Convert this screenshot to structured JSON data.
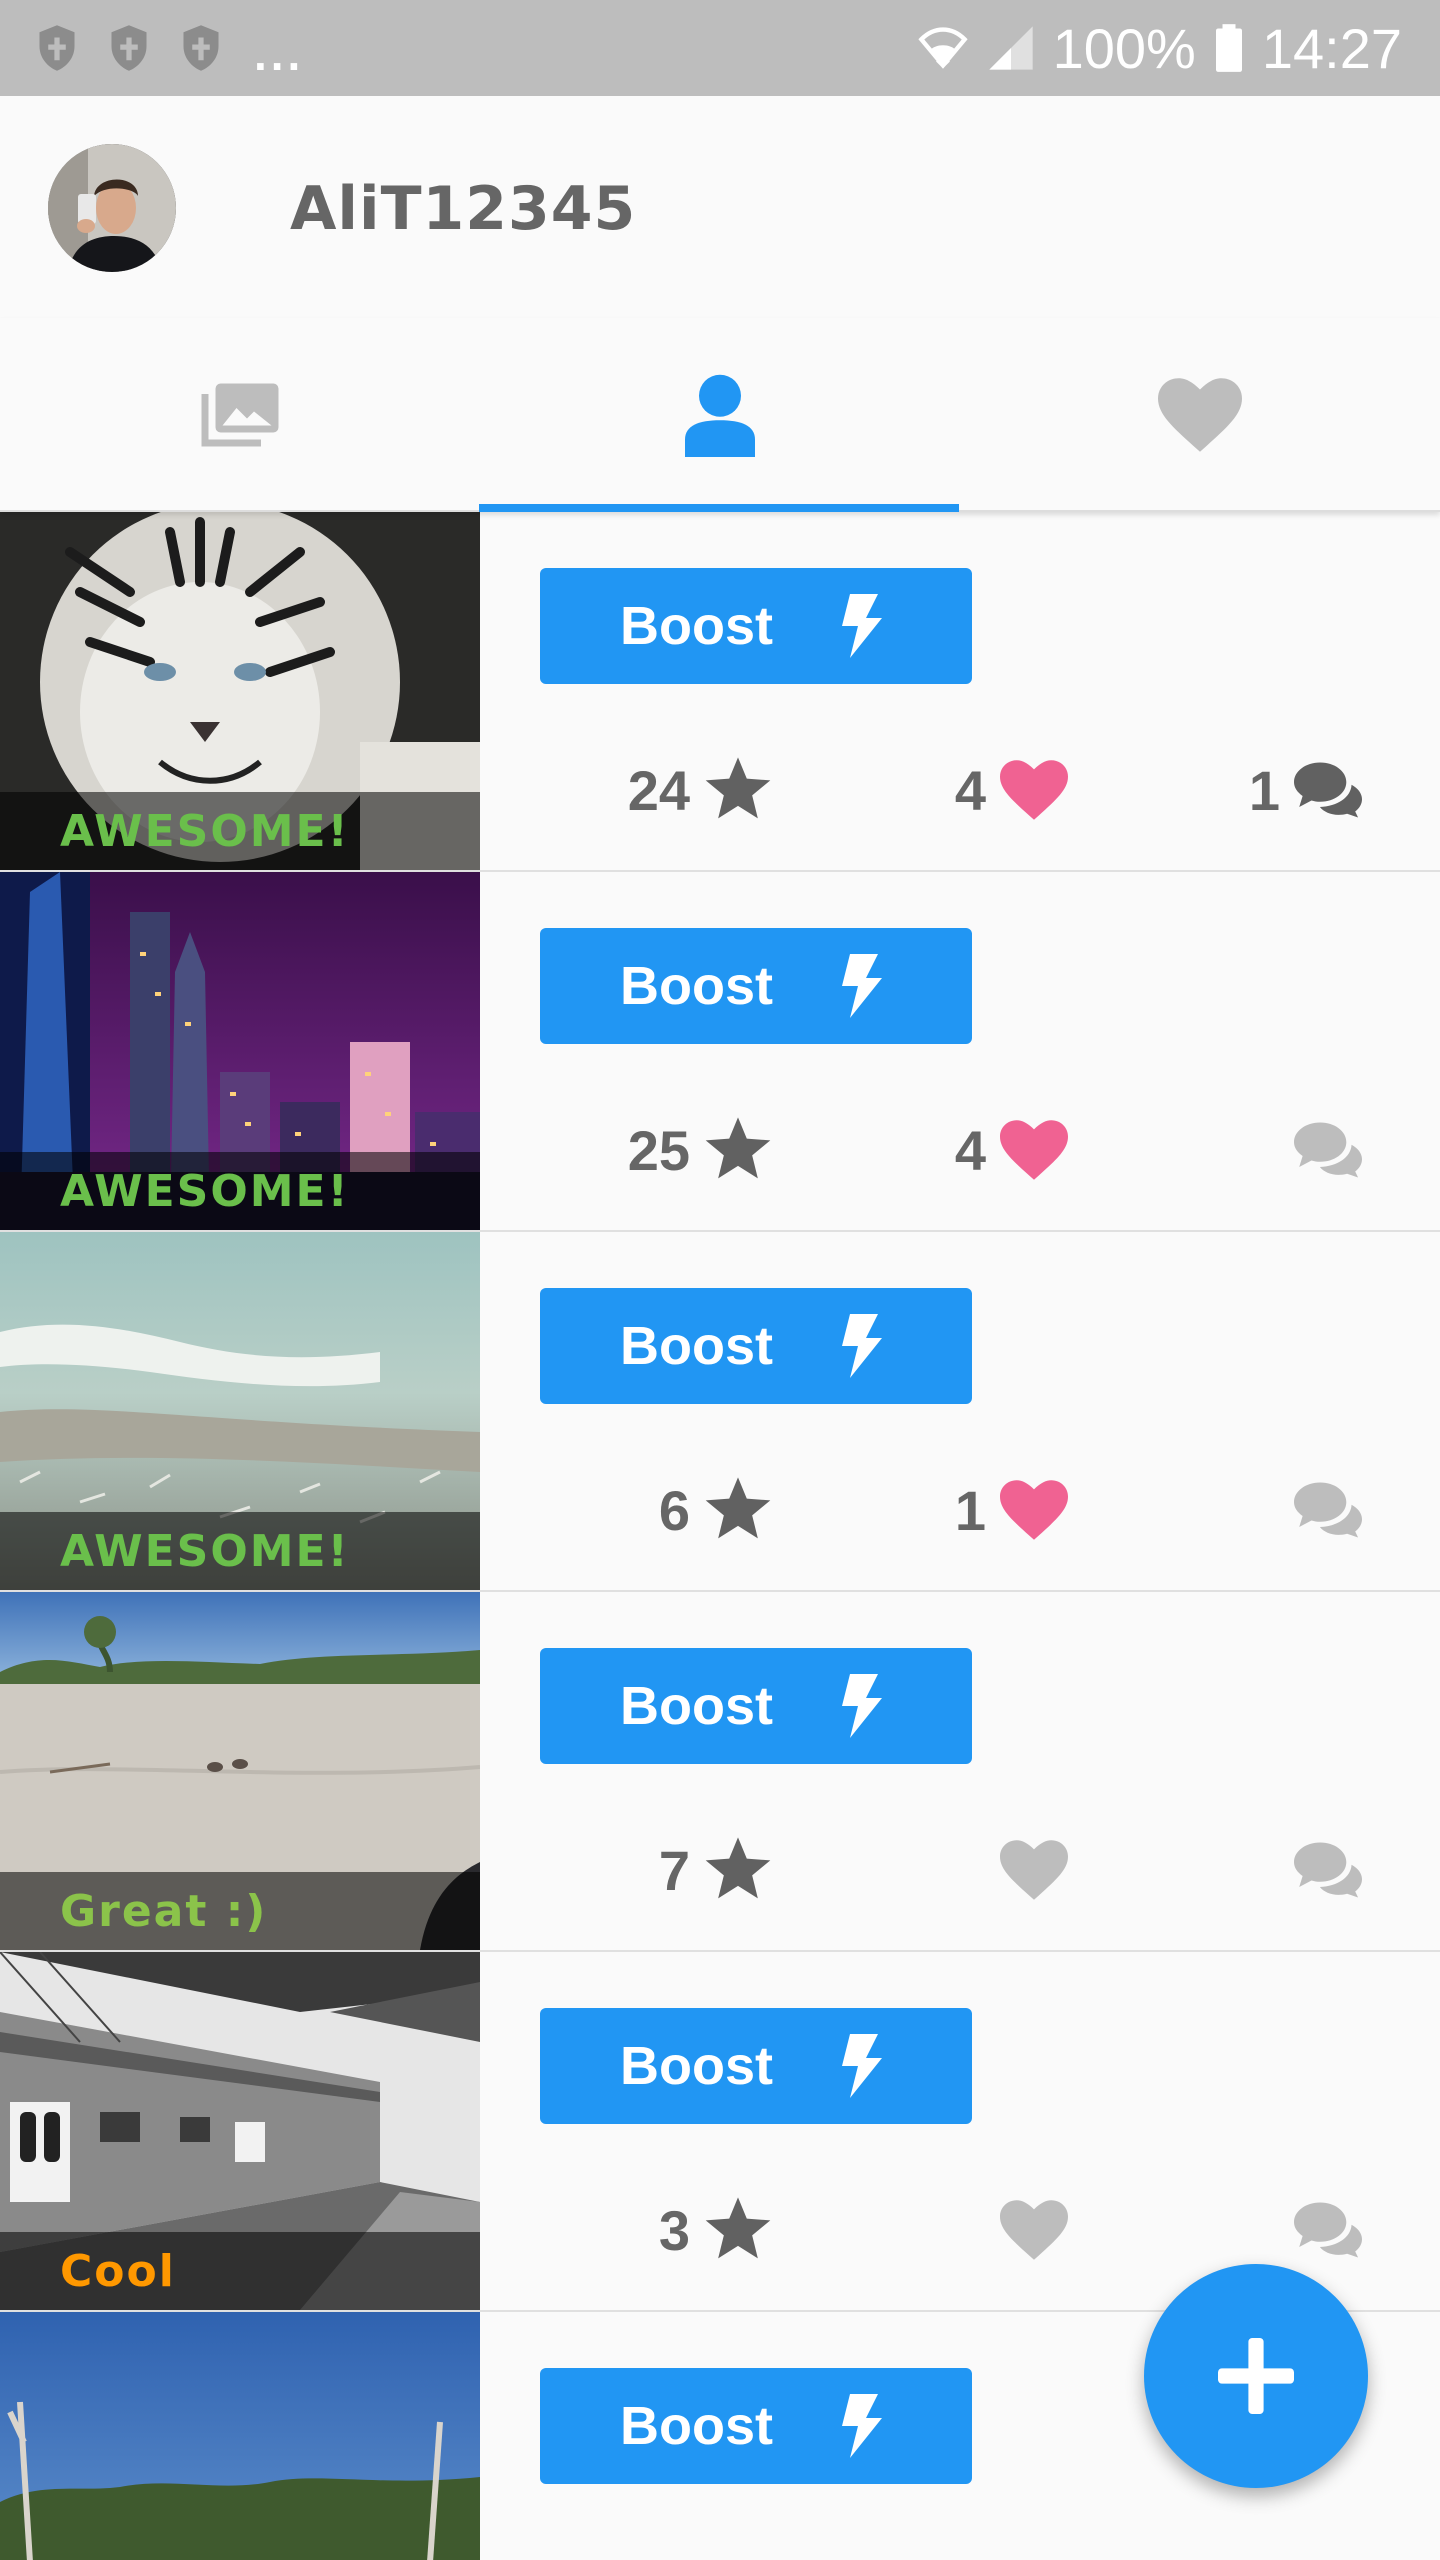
{
  "status_bar": {
    "notification_overflow": "...",
    "battery_percent": "100%",
    "time": "14:27"
  },
  "profile": {
    "username": "AliT12345"
  },
  "tabs": [
    {
      "icon": "photo-library-icon",
      "selected": false
    },
    {
      "icon": "person-icon",
      "selected": true
    },
    {
      "icon": "heart-icon",
      "selected": false
    }
  ],
  "posts": [
    {
      "caption": "AWESOME!",
      "caption_color": "#6abf4b",
      "boost_label": "Boost",
      "stars": "24",
      "likes": "4",
      "liked": true,
      "comments": "1",
      "has_comments": true
    },
    {
      "caption": "AWESOME!",
      "caption_color": "#6abf4b",
      "boost_label": "Boost",
      "stars": "25",
      "likes": "4",
      "liked": true,
      "comments": "",
      "has_comments": false
    },
    {
      "caption": "AWESOME!",
      "caption_color": "#6abf4b",
      "boost_label": "Boost",
      "stars": "6",
      "likes": "1",
      "liked": true,
      "comments": "",
      "has_comments": false
    },
    {
      "caption": "Great :)",
      "caption_color": "#8bc34a",
      "boost_label": "Boost",
      "stars": "7",
      "likes": "",
      "liked": false,
      "comments": "",
      "has_comments": false
    },
    {
      "caption": "Cool",
      "caption_color": "#ff9800",
      "boost_label": "Boost",
      "stars": "3",
      "likes": "",
      "liked": false,
      "comments": "",
      "has_comments": false
    },
    {
      "caption": "",
      "caption_color": "#6abf4b",
      "boost_label": "Boost",
      "stars": "",
      "likes": "",
      "liked": false,
      "comments": "",
      "has_comments": false
    }
  ],
  "colors": {
    "accent": "#2196f3",
    "like_active": "#f06292",
    "icon_inactive": "#bdbdbd",
    "stat_text": "#666666"
  },
  "fab": {
    "icon": "plus-icon"
  }
}
